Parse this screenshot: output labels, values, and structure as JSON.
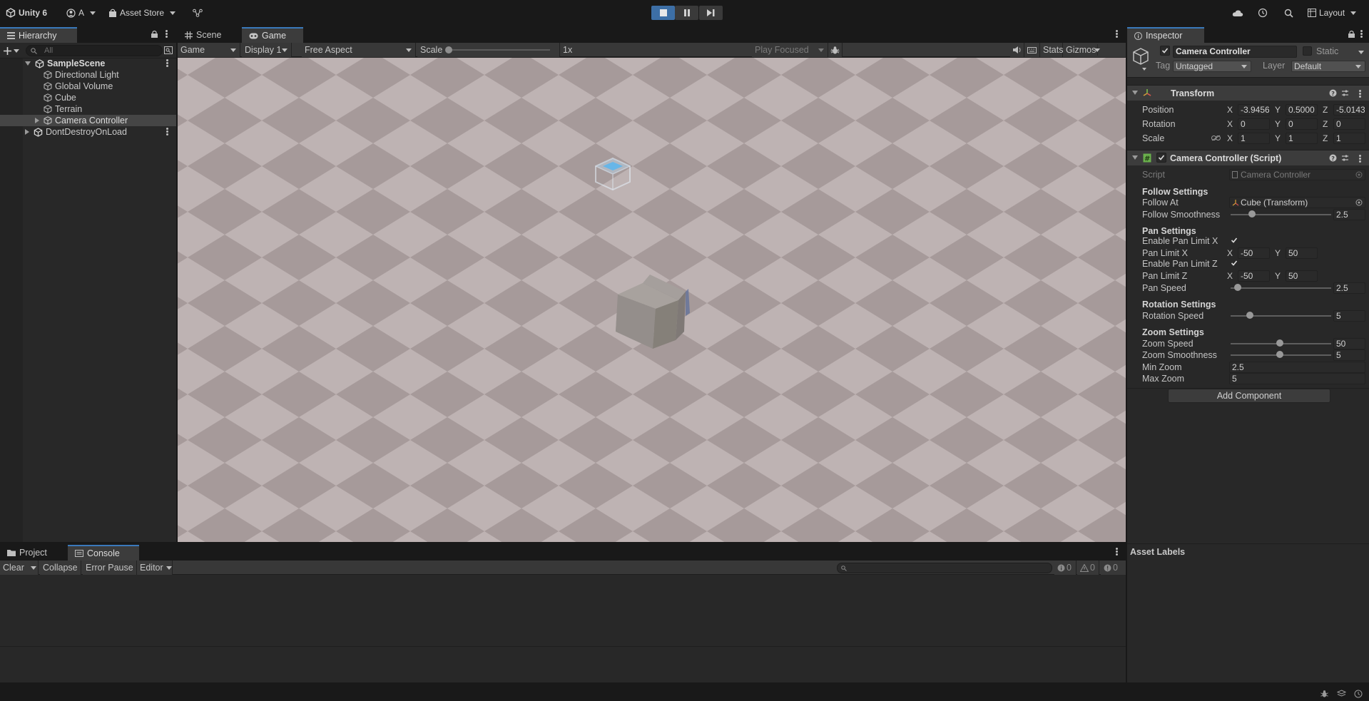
{
  "topbar": {
    "app_title": "Unity 6",
    "account": "A",
    "asset_store": "Asset Store",
    "layout": "Layout"
  },
  "hierarchy": {
    "tab": "Hierarchy",
    "search_placeholder": "All",
    "scene": "SampleScene",
    "items": [
      "Directional Light",
      "Global Volume",
      "Cube",
      "Terrain",
      "Camera Controller"
    ],
    "dont_destroy": "DontDestroyOnLoad"
  },
  "center": {
    "tabs": [
      "Scene",
      "Game"
    ],
    "toolbar": {
      "mode": "Game",
      "display": "Display 1",
      "aspect": "Free Aspect",
      "scale_label": "Scale",
      "scale_value": "1x",
      "scale_level": 0,
      "play_focused": "Play Focused",
      "stats": "Stats",
      "gizmos": "Gizmos"
    }
  },
  "inspector": {
    "tab": "Inspector",
    "object_name": "Camera Controller",
    "static_label": "Static",
    "tag_label": "Tag",
    "tag_value": "Untagged",
    "layer_label": "Layer",
    "layer_value": "Default",
    "transform": {
      "title": "Transform",
      "position_label": "Position",
      "position": [
        "-3.9456",
        "0.5000",
        "-5.0143"
      ],
      "rotation_label": "Rotation",
      "rotation": [
        "0",
        "0",
        "0"
      ],
      "scale_label": "Scale",
      "scale": [
        "1",
        "1",
        "1"
      ]
    },
    "script_comp": {
      "title": "Camera Controller (Script)",
      "script_label": "Script",
      "script_value": "Camera Controller",
      "follow_header": "Follow Settings",
      "follow_at_label": "Follow At",
      "follow_at_value": "Cube (Transform)",
      "follow_smooth_label": "Follow Smoothness",
      "follow_smooth_value": "2.5",
      "pan_header": "Pan Settings",
      "enable_pan_x_label": "Enable Pan Limit X",
      "enable_pan_x": true,
      "pan_limit_x_label": "Pan Limit X",
      "pan_limit_x": [
        "-50",
        "50"
      ],
      "enable_pan_z_label": "Enable Pan Limit Z",
      "enable_pan_z": true,
      "pan_limit_z_label": "Pan Limit Z",
      "pan_limit_z": [
        "-50",
        "50"
      ],
      "pan_speed_label": "Pan Speed",
      "pan_speed_value": "2.5",
      "rotation_header": "Rotation Settings",
      "rotation_speed_label": "Rotation Speed",
      "rotation_speed_value": "5",
      "zoom_header": "Zoom Settings",
      "zoom_speed_label": "Zoom Speed",
      "zoom_speed_value": "50",
      "zoom_smooth_label": "Zoom Smoothness",
      "zoom_smooth_value": "5",
      "min_zoom_label": "Min Zoom",
      "min_zoom_value": "2.5",
      "max_zoom_label": "Max Zoom",
      "max_zoom_value": "5"
    },
    "add_component": "Add Component",
    "asset_labels": "Asset Labels"
  },
  "bottom": {
    "tabs": [
      "Project",
      "Console"
    ],
    "toolbar": {
      "clear": "Clear",
      "collapse": "Collapse",
      "error_pause": "Error Pause",
      "editor": "Editor",
      "info_count": "0",
      "warn_count": "0",
      "error_count": "0"
    }
  }
}
